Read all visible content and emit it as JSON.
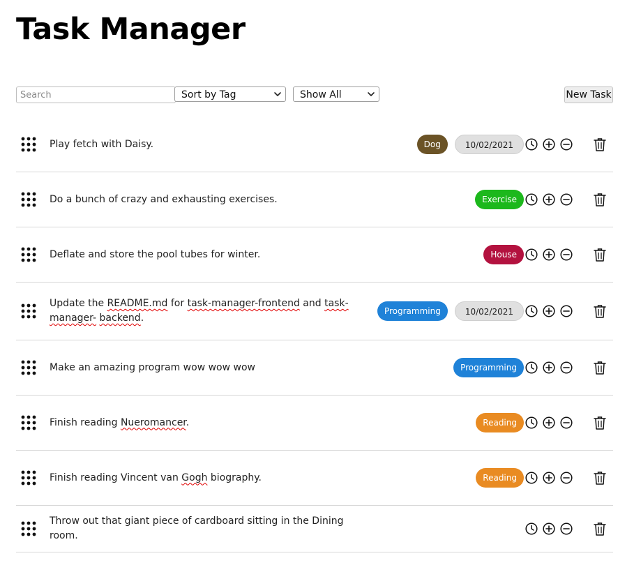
{
  "app": {
    "title": "Task Manager"
  },
  "toolbar": {
    "search_placeholder": "Search",
    "search_value": "",
    "sort_selected": "Sort by Tag",
    "filter_selected": "Show All",
    "new_task_label": "New Task"
  },
  "colors": {
    "Dog": "#6b5326",
    "Exercise": "#1cb81c",
    "House": "#b3123f",
    "Programming": "#1f82d8",
    "Reading": "#e98b22"
  },
  "icons": [
    "drag-handle-icon",
    "clock-icon",
    "plus-circle-icon",
    "minus-circle-icon",
    "trash-icon"
  ],
  "tasks": [
    {
      "parts": [
        {
          "t": "Play fetch with Daisy."
        }
      ],
      "tag": "Dog",
      "date": "10/02/2021"
    },
    {
      "parts": [
        {
          "t": "Do a bunch of crazy and exhausting exercises."
        }
      ],
      "tag": "Exercise",
      "date": ""
    },
    {
      "parts": [
        {
          "t": "Deflate and store the pool tubes for winter."
        }
      ],
      "tag": "House",
      "date": ""
    },
    {
      "parts": [
        {
          "t": "Update the "
        },
        {
          "t": "README.md",
          "sq": true
        },
        {
          "t": " for "
        },
        {
          "t": "task-manager-frontend",
          "sq": true
        },
        {
          "t": " and "
        },
        {
          "t": "task-manager-",
          "sq": true
        },
        {
          "t": " "
        },
        {
          "t": "backend",
          "sq": true
        },
        {
          "t": "."
        }
      ],
      "tag": "Programming",
      "date": "10/02/2021",
      "tall": true
    },
    {
      "parts": [
        {
          "t": "Make an amazing program wow wow wow"
        }
      ],
      "tag": "Programming",
      "date": ""
    },
    {
      "parts": [
        {
          "t": "Finish reading "
        },
        {
          "t": "Nueromancer",
          "sq": true
        },
        {
          "t": "."
        }
      ],
      "tag": "Reading",
      "date": ""
    },
    {
      "parts": [
        {
          "t": "Finish reading Vincent van "
        },
        {
          "t": "Gogh",
          "sq": true
        },
        {
          "t": " biography."
        }
      ],
      "tag": "Reading",
      "date": ""
    },
    {
      "parts": [
        {
          "t": "Throw out that giant piece of cardboard sitting in the Dining room."
        }
      ],
      "tag": "",
      "date": "",
      "last": true
    }
  ]
}
